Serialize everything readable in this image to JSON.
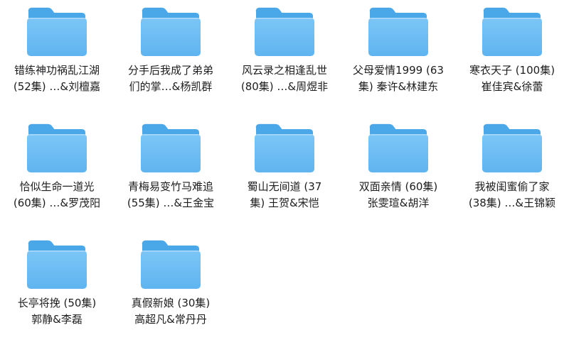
{
  "window": {
    "view": "icon-grid"
  },
  "icon": {
    "name": "folder-icon",
    "colors": {
      "back": "#4aa7e8",
      "front_top": "#7cc6f7",
      "front_bottom": "#5fb4ef",
      "tab_edge": "#3d97d8"
    }
  },
  "folders": [
    {
      "line1": "错练神功祸乱江湖",
      "line2": "(52集) …&刘檀嘉"
    },
    {
      "line1": "分手后我成了弟弟",
      "line2": "们的掌…&杨凯群"
    },
    {
      "line1": "风云录之相逢乱世",
      "line2": "(80集) …&周煜非"
    },
    {
      "line1": "父母爱情1999 (63",
      "line2": "集) 秦许&林建东"
    },
    {
      "line1": "寒衣天子 (100集)",
      "line2": "崔佳宾&徐蕾"
    },
    {
      "line1": "恰似生命一道光",
      "line2": "(60集) …&罗茂阳"
    },
    {
      "line1": "青梅易变竹马难追",
      "line2": "(55集) …&王金宝"
    },
    {
      "line1": "蜀山无间道 (37",
      "line2": "集) 王贺&宋恺"
    },
    {
      "line1": "双面亲情 (60集)",
      "line2": "张雯瑄&胡洋"
    },
    {
      "line1": "我被闺蜜偷了家",
      "line2": "(38集) …&王锦颖"
    },
    {
      "line1": "长亭将挽 (50集)",
      "line2": "郭静&李磊"
    },
    {
      "line1": "真假新娘 (30集)",
      "line2": "高超凡&常丹丹"
    }
  ]
}
